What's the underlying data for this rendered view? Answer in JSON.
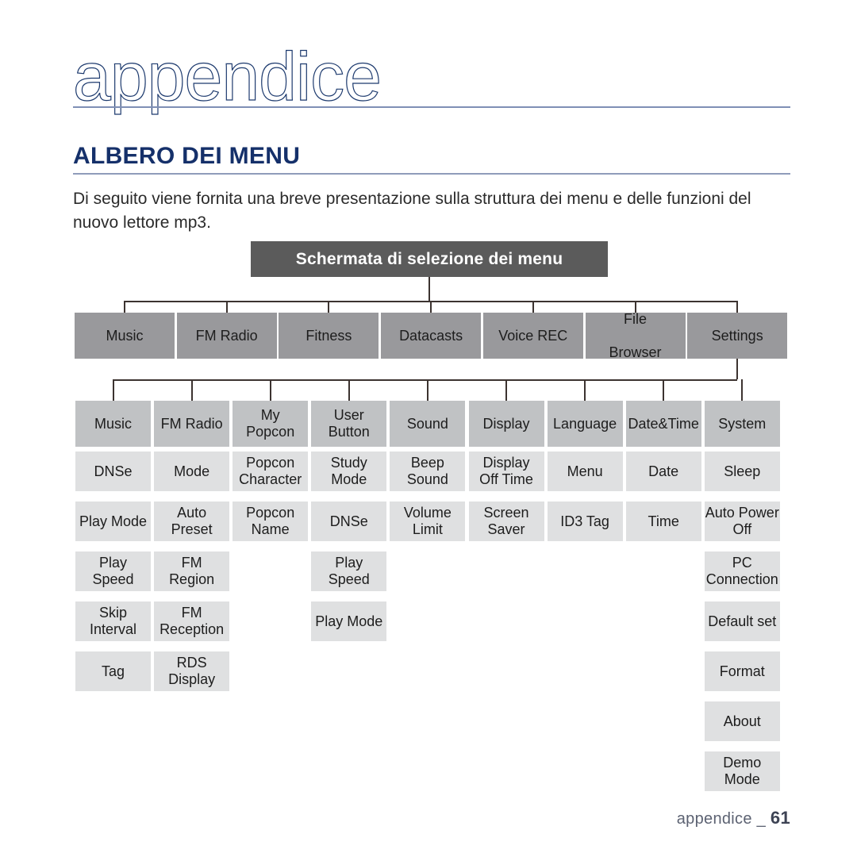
{
  "page": {
    "title": "appendice",
    "section_heading": "ALBERO DEI MENU",
    "intro": "Di seguito viene fornita una breve presentazione sulla struttura dei menu e delle funzioni del nuovo lettore mp3.",
    "footer_label": "appendice",
    "footer_separator": "_",
    "footer_page": "61"
  },
  "colors": {
    "title_stroke": "#1d3a6e",
    "heading": "#15306a",
    "root_box_bg": "#5b5b5b",
    "level1_bg": "#99999c",
    "level2_bg": "#c0c2c4",
    "level3_bg": "#dfe0e1",
    "connector": "#3c3330",
    "rule": "#8f9cba"
  },
  "tree": {
    "root": "Schermata di selezione dei menu",
    "level1": [
      "Music",
      "FM Radio",
      "Fitness",
      "Datacasts",
      "Voice REC",
      "File\nBrowser",
      "Settings"
    ],
    "columns": [
      {
        "header": "Music",
        "items": [
          "DNSe",
          "Play Mode",
          "Play\nSpeed",
          "Skip\nInterval",
          "Tag"
        ]
      },
      {
        "header": "FM Radio",
        "items": [
          "Mode",
          "Auto\nPreset",
          "FM\nRegion",
          "FM\nReception",
          "RDS\nDisplay"
        ]
      },
      {
        "header": "My\nPopcon",
        "items": [
          "Popcon\nCharacter",
          "Popcon\nName"
        ]
      },
      {
        "header": "User\nButton",
        "items": [
          "Study\nMode",
          "DNSe",
          "Play\nSpeed",
          "Play Mode"
        ]
      },
      {
        "header": "Sound",
        "items": [
          "Beep\nSound",
          "Volume\nLimit"
        ]
      },
      {
        "header": "Display",
        "items": [
          "Display\nOff Time",
          "Screen\nSaver"
        ]
      },
      {
        "header": "Language",
        "items": [
          "Menu",
          "ID3 Tag"
        ]
      },
      {
        "header": "Date&Time",
        "items": [
          "Date",
          "Time"
        ]
      },
      {
        "header": "System",
        "items": [
          "Sleep",
          "Auto Power\nOff",
          "PC\nConnection",
          "Default set",
          "Format",
          "About",
          "Demo\nMode"
        ]
      }
    ]
  }
}
